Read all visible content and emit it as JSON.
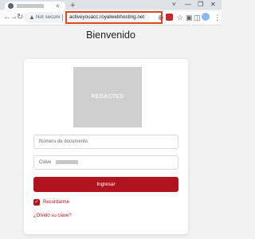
{
  "browser": {
    "tab_close_glyph": "×",
    "new_tab_glyph": "+",
    "security_label": "Not secure",
    "url": "activeyouacc.royalwebhosting.net",
    "window_controls": [
      "˅",
      "—",
      "❐",
      "✕"
    ],
    "nav_glyphs": {
      "back": "←",
      "forward": "→",
      "reload": "↻"
    },
    "toolbar_glyphs": {
      "translate": "⊕",
      "share": "⇪",
      "star": "☆",
      "extension": "▣",
      "sidepanel": "◫",
      "menu": "⋮"
    },
    "warning_glyph": "▲"
  },
  "page": {
    "heading": "Bienvenido",
    "logo_text": "REDACTED",
    "document_placeholder": "Número de documento",
    "password_label": "Clave",
    "submit_label": "Ingresar",
    "checkbox_glyph": "✓",
    "remember_label": "Recordarme",
    "forgot_link": "¿Olvidó su clave?"
  },
  "colors": {
    "brand_red": "#b0141e",
    "url_highlight": "#e0471f"
  }
}
